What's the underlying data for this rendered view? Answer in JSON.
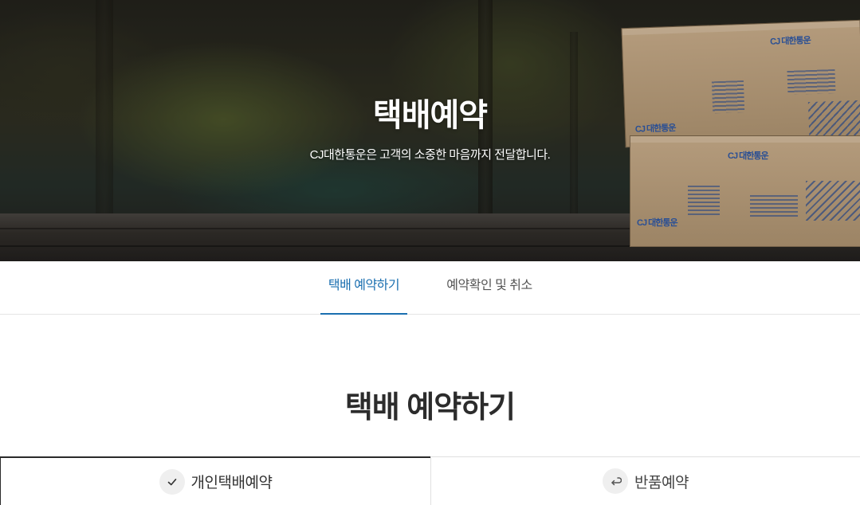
{
  "hero": {
    "title": "택배예약",
    "subtitle": "CJ대한통운은 고객의 소중한 마음까지 전달합니다.",
    "box_logo": "CJ 대한통운"
  },
  "tabs": [
    {
      "label": "택배 예약하기",
      "active": true
    },
    {
      "label": "예약확인 및 취소",
      "active": false
    }
  ],
  "section": {
    "title": "택배 예약하기"
  },
  "reservation_types": [
    {
      "label": "개인택배예약",
      "icon": "check-icon",
      "active": true
    },
    {
      "label": "반품예약",
      "icon": "return-arrow-icon",
      "active": false
    }
  ],
  "colors": {
    "accent": "#1a6fb0",
    "title_text": "#2c2c2c",
    "active_border": "#2a2a2a"
  }
}
